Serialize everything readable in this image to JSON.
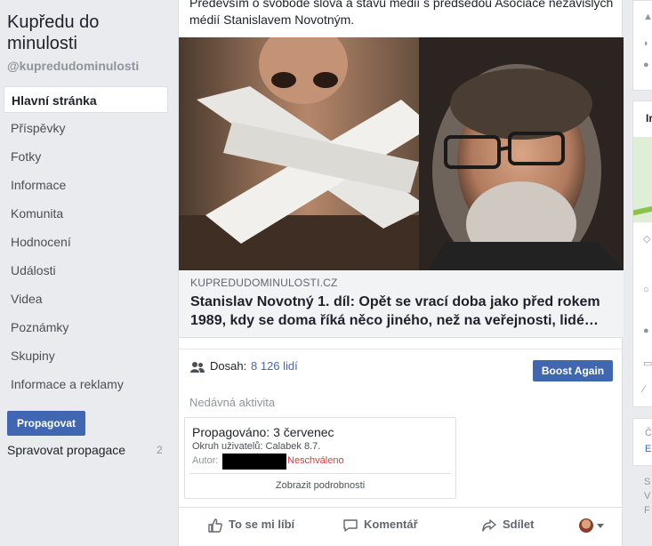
{
  "sidebar": {
    "page_title": "Kupředu do minulosti",
    "page_handle": "@kupredudominulosti",
    "items": [
      {
        "label": "Hlavní stránka",
        "active": true
      },
      {
        "label": "Příspěvky"
      },
      {
        "label": "Fotky"
      },
      {
        "label": "Informace"
      },
      {
        "label": "Komunita"
      },
      {
        "label": "Hodnocení"
      },
      {
        "label": "Události"
      },
      {
        "label": "Videa"
      },
      {
        "label": "Poznámky"
      },
      {
        "label": "Skupiny"
      },
      {
        "label": "Informace a reklamy"
      }
    ],
    "promote_label": "Propagovat",
    "manage_promotions_label": "Spravovat propagace",
    "manage_promotions_count": "2"
  },
  "post": {
    "text": "Především o svobodě slova a stavu médií s předsedou Asociace nezávislých médií Stanislavem Novotným.",
    "link": {
      "domain": "KUPREDUDOMINULOSTI.CZ",
      "title": "Stanislav Novotný 1. díl: Opět se vrací doba jako před rokem 1989, kdy se doma říká něco jiného, než na veřejnosti, lidé…"
    },
    "reach": {
      "label": "Dosah:",
      "value": "8 126 lidí"
    },
    "boost_label": "Boost Again",
    "recent_activity_label": "Nedávná aktivita",
    "activity": {
      "title": "Propagováno: 3 červenec",
      "audience": "Okruh uživatelů: Calabek 8.7.",
      "author_label": "Autor:",
      "status": "Neschváleno",
      "details_link": "Zobrazit podrobnosti"
    },
    "actions": {
      "like": "To se mi líbí",
      "comment": "Komentář",
      "share": "Sdílet"
    }
  },
  "right_column": {
    "card2_heading_letter": "Ir",
    "card3_letters": [
      "Č",
      "E"
    ],
    "footer_letters": [
      "S",
      "V",
      "F"
    ]
  },
  "colors": {
    "brand_blue": "#4267b2",
    "status_red": "#e0393e",
    "page_background": "#e9ebee"
  }
}
